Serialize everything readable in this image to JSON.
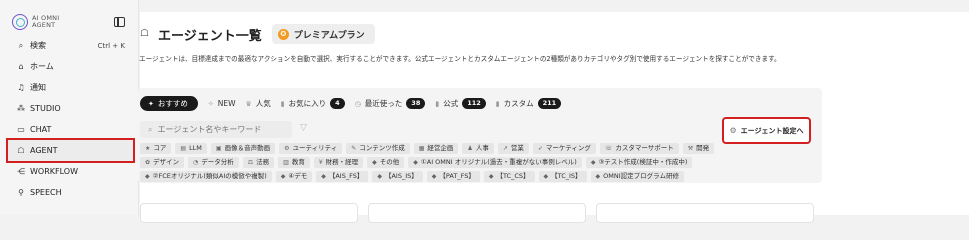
{
  "sidebar": {
    "logo_text": "AI OMNI\nAGENT",
    "items": [
      {
        "icon": "search-icon",
        "glyph": "⌕",
        "label": "検索",
        "shortcut": "Ctrl + K"
      },
      {
        "icon": "home-icon",
        "glyph": "⌂",
        "label": "ホーム"
      },
      {
        "icon": "bell-icon",
        "glyph": "♫",
        "label": "通知"
      },
      {
        "icon": "nodes-icon",
        "glyph": "⁂",
        "label": "STUDIO"
      },
      {
        "icon": "chat-icon",
        "glyph": "▭",
        "label": "CHAT"
      },
      {
        "icon": "agent-icon",
        "glyph": "☖",
        "label": "AGENT",
        "active": true
      },
      {
        "icon": "workflow-icon",
        "glyph": "⋲",
        "label": "WORKFLOW"
      },
      {
        "icon": "mic-icon",
        "glyph": "⚲",
        "label": "SPEECH"
      }
    ]
  },
  "header": {
    "title": "エージェント一覧",
    "plan_badge": "プレミアムプラン"
  },
  "description": "エージェントは、目標達成までの最適なアクションを自動で選択、実行することができます。公式エージェントとカスタムエージェントの2種類がありカテゴリやタグ別で使用するエージェントを探すことができます。",
  "tabs": [
    {
      "icon": "sparkle-icon",
      "glyph": "✦",
      "label": "おすすめ",
      "active": true
    },
    {
      "icon": "new-icon",
      "glyph": "✧",
      "label": "NEW"
    },
    {
      "icon": "crown-icon",
      "glyph": "♛",
      "label": "人気"
    },
    {
      "icon": "bookmark-icon",
      "glyph": "▮",
      "label": "お気に入り",
      "count": "4"
    },
    {
      "icon": "clock-icon",
      "glyph": "◷",
      "label": "最近使った",
      "count": "38"
    },
    {
      "icon": "official-icon",
      "glyph": "▮",
      "label": "公式",
      "count": "112"
    },
    {
      "icon": "custom-icon",
      "glyph": "▮",
      "label": "カスタム",
      "count": "211"
    }
  ],
  "search": {
    "placeholder": "エージェント名やキーワード"
  },
  "settings_button": "エージェント設定へ",
  "tags": [
    {
      "glyph": "★",
      "label": "コア"
    },
    {
      "glyph": "▤",
      "label": "LLM"
    },
    {
      "glyph": "▣",
      "label": "画像＆音声動画"
    },
    {
      "glyph": "⚙",
      "label": "ユーティリティ"
    },
    {
      "glyph": "✎",
      "label": "コンテンツ作成"
    },
    {
      "glyph": "▦",
      "label": "経営企画"
    },
    {
      "glyph": "♟",
      "label": "人事"
    },
    {
      "glyph": "↗",
      "label": "営業"
    },
    {
      "glyph": "➶",
      "label": "マーケティング"
    },
    {
      "glyph": "☏",
      "label": "カスタマーサポート"
    },
    {
      "glyph": "⚒",
      "label": "開発"
    },
    {
      "glyph": "✿",
      "label": "デザイン"
    },
    {
      "glyph": "◔",
      "label": "データ分析"
    },
    {
      "glyph": "⚖",
      "label": "法務"
    },
    {
      "glyph": "▥",
      "label": "教育"
    },
    {
      "glyph": "¥",
      "label": "財務・経理"
    },
    {
      "glyph": "◆",
      "label": "その他"
    },
    {
      "glyph": "◆",
      "label": "①AI OMNI オリジナル(過去・重複がない事例レベル)"
    },
    {
      "glyph": "◆",
      "label": "③テスト作成(検証中・作成中)"
    },
    {
      "glyph": "◆",
      "label": "②FCEオリジナル(類似AIの模倣や複製)"
    },
    {
      "glyph": "◆",
      "label": "④デモ"
    },
    {
      "glyph": "◆",
      "label": "【AIS_FS】"
    },
    {
      "glyph": "◆",
      "label": "【AIS_IS】"
    },
    {
      "glyph": "◆",
      "label": "【PAT_FS】"
    },
    {
      "glyph": "◆",
      "label": "【TC_CS】"
    },
    {
      "glyph": "◆",
      "label": "【TC_IS】"
    },
    {
      "glyph": "◆",
      "label": "OMNI認定プログラム研修"
    }
  ],
  "colors": {
    "highlight": "#d21f1f",
    "plan": "#f29a1f",
    "dark": "#1a1a1a"
  }
}
